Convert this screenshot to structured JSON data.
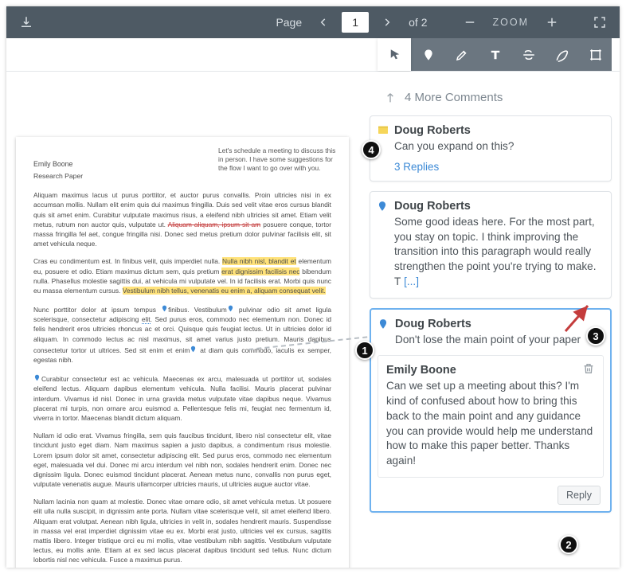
{
  "toolbar": {
    "page_label": "Page",
    "page_current": "1",
    "page_total": "of 2",
    "zoom_label": "ZOOM"
  },
  "document": {
    "author": "Emily Boone",
    "title": "Research Paper",
    "side_note": "Let's schedule a meeting to discuss this in person. I have some suggestions for the flow I want to go over with you.",
    "para1a": "Aliquam maximus lacus ut purus porttitor, et auctor purus convallis. Proin ultricies nisi in ex accumsan mollis. Nullam elit enim quis dui maximus fringilla. Duis sed velit vitae eros cursus blandit quis sit amet enim. Curabitur vulputate maximus risus, a eleifend nibh ultricies sit amet. Etiam velit metus, rutrum non auctor quis, vulputate ut. ",
    "para1b": "Aliquam aliquam, ipsum sit am",
    "para1c": " posuere conque, tortor massa fringilla fel aet, congue fringilla nisi. Donec sed metus pretium dolor pulvinar facilisis elit, sit amet vehicula neque.",
    "para2a": "Cras eu condimentum est. In finibus velit, quis imperdiet nulla. ",
    "para2b": "Nulla nibh nisl, blandit et",
    "para2c": " elementum eu, posuere et odio. Etiam maximus dictum sem, quis pretium ",
    "para2d": "erat dignissim facilisis nec",
    "para2e": " bibendum nulla. Phasellus molestie sagittis dui, at vehicula mi vulputate vel. In id facilisis erat. Morbi quis nunc eu massa elementum cursus. ",
    "para2f": "Vestibulum nibh tellus, venenatis eu enim a, aliquam consequat velit.",
    "para3a": "Nunc porttitor dolor at ipsum tempus ",
    "para3a_pin": "finibus",
    "para3a2": ". Vestibulum",
    "para3a3": " pulvinar odio sit amet ligula scelerisque, consectetur adipiscing ",
    "para3b": "elit",
    "para3c": ". Sed purus eros, commodo nec elementum non. Donec id felis hendrerit eros ultricies rhoncus ac et orci. Quisque quis feugiat lectus. Ut in ultricies dolor id aliquam. In commodo lectus ac nisl maximus, sit amet varius justo pretium. Mauris dapibus consectetur tortor ut ultrices. Sed sit enim et enim",
    "para3d": " at diam quis commodo, iaculis ex semper, egestas nibh.",
    "para4": "Curabitur consectetur est ac vehicula. Ma͏ecenas ex arcu, malesuada ut porttitor ut, sodales eleifend lectus. Aliquam dapibus elementum vehicula. Nulla facilisi. Mauris placerat pulvinar interdum. Vivamus id nisl. Donec in urna gravida metus vulputate vitae dapibus neque. Vivamus placerat mi turpis, non ornare arcu euismod a. Pellentesque felis mi, feugiat nec fermentum id, viverra in tortor. Maecenas blandit dictum aliquam.",
    "para5": "Nullam id odio erat. Vivamus fringilla, sem quis faucibus tincidunt, libero nisl consectetur elit, vitae tincidunt justo eget diam. Nam maximus sapien a justo dapibus, a condimentum risus molestie. Lorem ipsum dolor sit amet, consectetur adipiscing elit. Sed purus eros, commodo nec elementum eget, malesuada vel dui. Donec mi arcu interdum vel nibh non, sodales hendrerit enim. Donec nec dignissim ligula. Donec euismod tincidunt placerat. Aenean metus nunc, convallis non purus eget, vulputate venenatis augue. Mauris ullamcorper ultricies mauris, ut ultricies augue auctor vitae.",
    "para6": "Nullam lacinia non quam at molestie. Donec vitae ornare odio, sit amet vehicula metus. Ut posuere elit ulla nulla suscipit, in dignissim ante porta. Nullam vitae scelerisque velit, sit amet eleifend libero. Aliquam erat volutpat. Aenean nibh ligula, ultricies in velit in, sodales hendrerit mauris. Suspendisse in massa vel erat imperdiet dignissim vitae eu ex. Morbi erat justo, ultricies vel ex cursus, sagittis mattis libero. Integer tristique orci eu mi mollis, vitae vestibulum nibh sagittis. Vestibulum vulputate lectus, eu mollis ante. Etiam at ex sed lacus placerat dapibus tincidunt sed tellus. Nunc dictum lobortis nisl nec vehicula. Fusce a maximus purus."
  },
  "comments": {
    "more_label": "4 More Comments",
    "items": [
      {
        "icon": "note",
        "author": "Doug Roberts",
        "body": "Can you expand on this?",
        "replies_label": "3 Replies"
      },
      {
        "icon": "pin",
        "author": "Doug Roberts",
        "body": "Some good ideas here. For the most part, you stay on topic. I think improving the transition into this paragraph would really strengthen the point you're trying to make. T",
        "expand": " [...]"
      },
      {
        "icon": "pin",
        "author": "Doug Roberts",
        "body": "Don't lose the main point of your paper",
        "sub_author": "Emily Boone",
        "sub_body": "Can we set up a meeting about this? I'm kind of confused about how to bring this back to the main point and any guidance you can provide would help me understand how to make this paper better. Thanks again!",
        "reply_label": "Reply"
      }
    ]
  },
  "callouts": {
    "c1": "1",
    "c2": "2",
    "c3": "3",
    "c4": "4"
  }
}
